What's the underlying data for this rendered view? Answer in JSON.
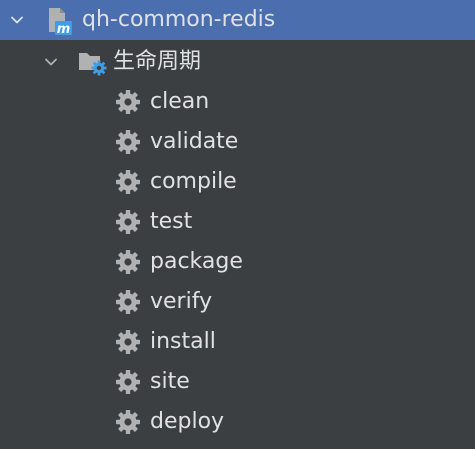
{
  "tree": {
    "root": {
      "label": "qh-common-redis",
      "icon": "maven-module-icon",
      "expanded": true,
      "selected": true
    },
    "lifecycle": {
      "label": "生命周期",
      "icon": "folder-gear-icon",
      "expanded": true
    },
    "phases": [
      {
        "label": "clean",
        "icon": "gear-icon"
      },
      {
        "label": "validate",
        "icon": "gear-icon"
      },
      {
        "label": "compile",
        "icon": "gear-icon"
      },
      {
        "label": "test",
        "icon": "gear-icon"
      },
      {
        "label": "package",
        "icon": "gear-icon"
      },
      {
        "label": "verify",
        "icon": "gear-icon"
      },
      {
        "label": "install",
        "icon": "gear-icon"
      },
      {
        "label": "site",
        "icon": "gear-icon"
      },
      {
        "label": "deploy",
        "icon": "gear-icon"
      }
    ]
  },
  "colors": {
    "background": "#3c3f41",
    "selection": "#4b6eaf",
    "text": "#dfe1e5",
    "icon": "#afb1b3",
    "accent": "#3d9ee6"
  }
}
